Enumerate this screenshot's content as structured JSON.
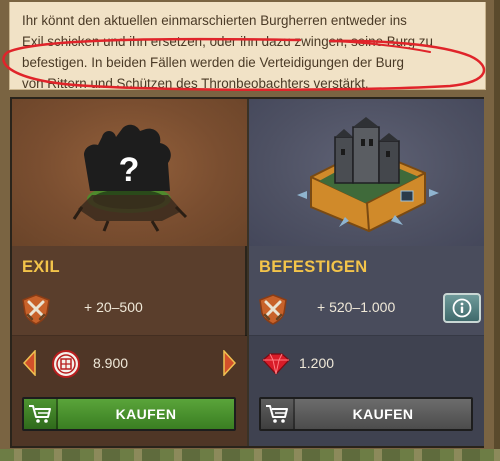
{
  "description": {
    "line1": "Ihr könnt den aktuellen einmarschierten Burgherren entweder ins",
    "line2": "Exil schicken und ihn ersetzen, oder ihn dazu zwingen, seine Burg zu",
    "line3": "befestigen. In beiden Fällen werden die Verteidigungen der Burg",
    "line4": "von Rittern und Schützen des Thronbeobachters verstärkt."
  },
  "annotation_color": "#e0242a",
  "options": [
    {
      "title": "EXIL",
      "range": "+ 20–500",
      "price": "8.900",
      "currency_icon": "coin-icon",
      "buy_label": "KAUFEN",
      "buy_color": "#4a9a30"
    },
    {
      "title": "BEFESTIGEN",
      "range": "+ 520–1.000",
      "price": "1.200",
      "currency_icon": "ruby-icon",
      "buy_label": "KAUFEN",
      "buy_color": "#5a5a5a"
    }
  ],
  "colors": {
    "title": "#f3c44a",
    "panel_left": "#5a3e2c",
    "panel_right": "#494c5c",
    "parchment": "#f1e2c6"
  }
}
